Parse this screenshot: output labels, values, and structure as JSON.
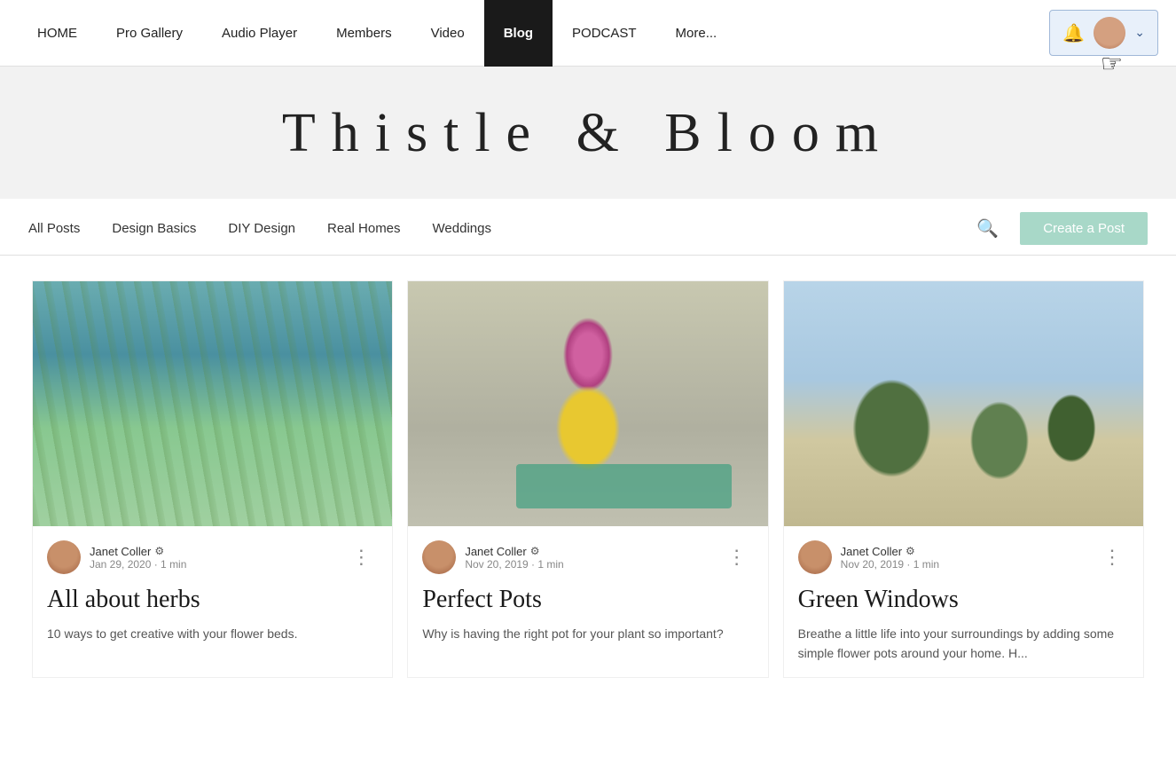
{
  "nav": {
    "links": [
      {
        "label": "HOME",
        "active": false
      },
      {
        "label": "Pro Gallery",
        "active": false
      },
      {
        "label": "Audio Player",
        "active": false
      },
      {
        "label": "Members",
        "active": false
      },
      {
        "label": "Video",
        "active": false
      },
      {
        "label": "Blog",
        "active": true
      },
      {
        "label": "PODCAST",
        "active": false
      },
      {
        "label": "More...",
        "active": false
      }
    ],
    "bell_icon": "🔔",
    "chevron_icon": "⌄"
  },
  "hero": {
    "title": "Thistle & Bloom"
  },
  "filter_bar": {
    "links": [
      {
        "label": "All Posts"
      },
      {
        "label": "Design Basics"
      },
      {
        "label": "DIY Design"
      },
      {
        "label": "Real Homes"
      },
      {
        "label": "Weddings"
      }
    ],
    "create_button": "Create a Post"
  },
  "posts": [
    {
      "author": "Janet Coller",
      "date": "Jan 29, 2020",
      "read_time": "1 min",
      "title": "All about herbs",
      "excerpt": "10 ways to get creative with your flower beds.",
      "image_class": "img-herbs"
    },
    {
      "author": "Janet Coller",
      "date": "Nov 20, 2019",
      "read_time": "1 min",
      "title": "Perfect Pots",
      "excerpt": "Why is having the right pot for your plant so important?",
      "image_class": "img-pots"
    },
    {
      "author": "Janet Coller",
      "date": "Nov 20, 2019",
      "read_time": "1 min",
      "title": "Green Windows",
      "excerpt": "Breathe a little life into your surroundings by adding some simple flower pots around your home. H...",
      "image_class": "img-windows"
    }
  ],
  "colors": {
    "nav_active_bg": "#1a1a1a",
    "create_btn_bg": "#a8d8c8",
    "user_area_bg": "#e8f0fa",
    "user_area_border": "#a0b8d8"
  }
}
